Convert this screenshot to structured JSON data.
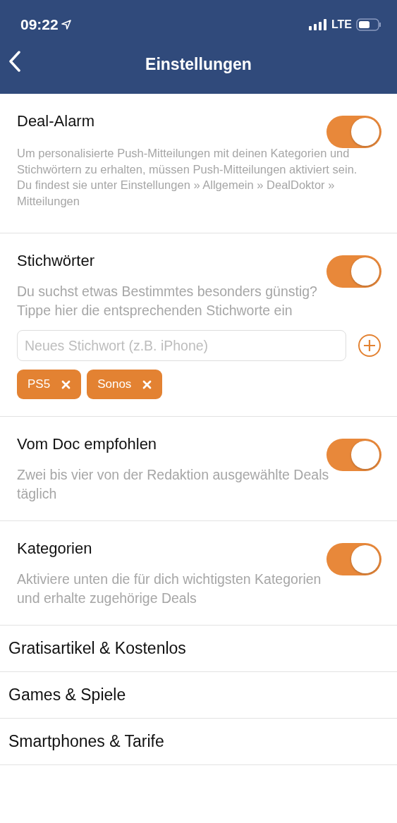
{
  "status_bar": {
    "time": "09:22",
    "network": "LTE"
  },
  "nav": {
    "title": "Einstellungen"
  },
  "sections": [
    {
      "kind": "note",
      "title": "Deal-Alarm",
      "on": true,
      "description": "Um personalisierte Push-Mitteilungen mit deinen Kategorien und Stichwörtern zu erhalten, müssen Push-Mitteilungen aktiviert sein.\nDu findest sie unter Einstellungen » Allgemein » DealDoktor » Mitteilungen"
    },
    {
      "kind": "keywords",
      "title": "Stichwörter",
      "on": true,
      "description": "Du suchst etwas Bestimmtes besonders günstig? Tippe hier die entsprechenden Stichworte ein",
      "placeholder": "Neues Stichwort (z.B. iPhone)",
      "tags": [
        "PS5",
        "Sonos"
      ]
    },
    {
      "kind": "toggle",
      "title": "Vom Doc empfohlen",
      "on": true,
      "description": "Zwei bis vier von der Redaktion ausgewählte Deals täglich"
    },
    {
      "kind": "toggle",
      "title": "Kategorien",
      "on": true,
      "description": "Aktiviere unten die für dich wichtigsten Kategorien und erhalte zugehörige Deals"
    }
  ],
  "categories": [
    "Gratisartikel & Kostenlos",
    "Games & Spiele",
    "Smartphones & Tarife"
  ]
}
